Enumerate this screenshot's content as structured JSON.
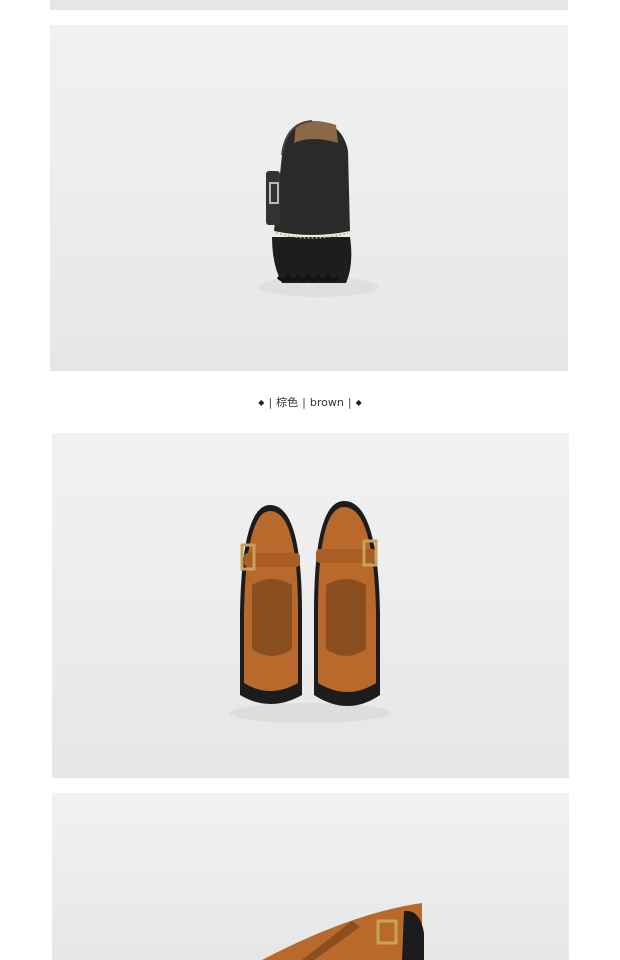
{
  "caption": {
    "diamond_left": "◆",
    "sep1": "|",
    "color_cn": "棕色",
    "sep2": "|",
    "color_en": "brown",
    "sep3": "|",
    "diamond_right": "◆"
  },
  "photos": {
    "black_shoe": {
      "shoe_color": "#2a2a2a",
      "stitch_color": "#c9a55a"
    },
    "brown_shoes": {
      "shoe_color": "#b8692b",
      "sole_color": "#1c1c1c",
      "buckle_color": "#c8a258"
    }
  }
}
